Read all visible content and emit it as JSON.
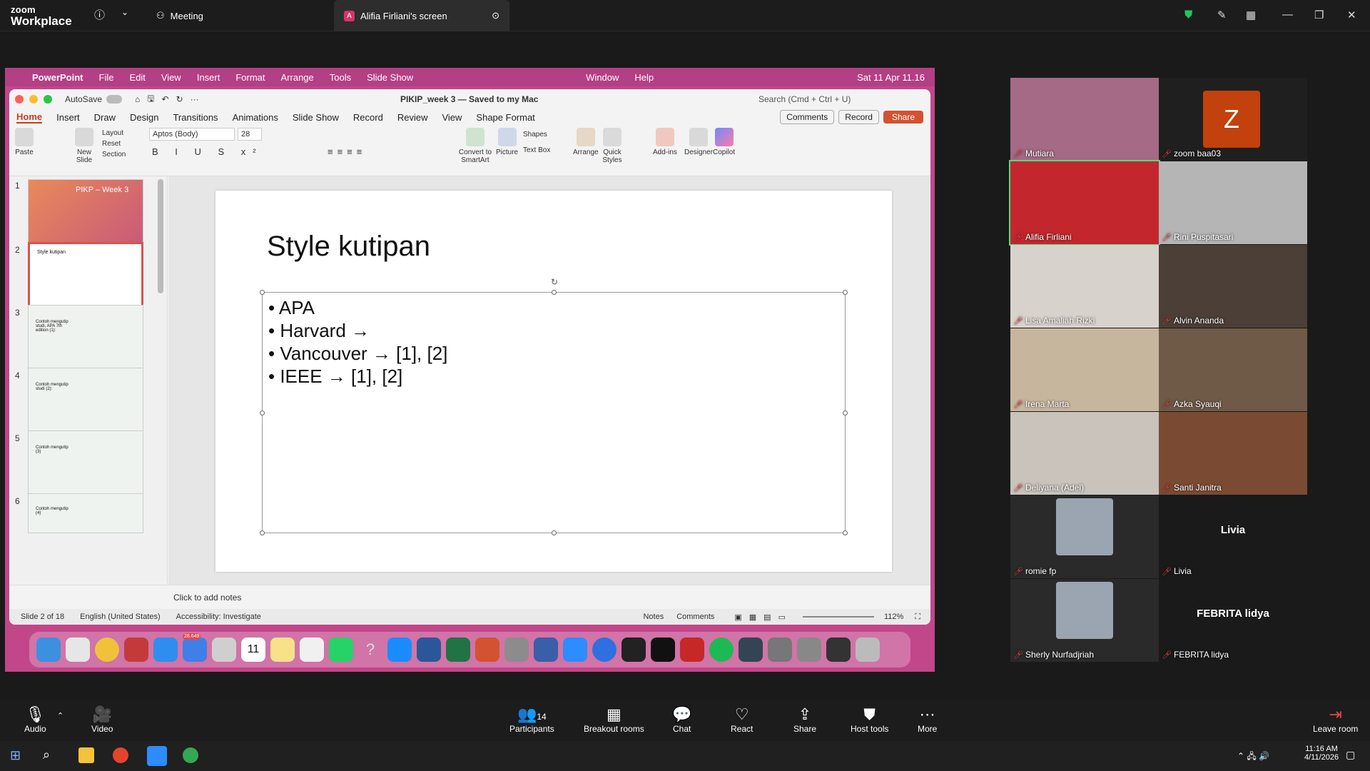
{
  "zoom": {
    "logo_line1": "zoom",
    "logo_line2": "Workplace",
    "tab_meeting": "Meeting",
    "tab_screen": "Alifia Firliani's screen",
    "avatar_letter": "A"
  },
  "mac_menu": {
    "app": "PowerPoint",
    "items": [
      "File",
      "Edit",
      "View",
      "Insert",
      "Format",
      "Arrange",
      "Tools",
      "Slide Show"
    ],
    "right": [
      "Window",
      "Help"
    ],
    "clock": "Sat 11 Apr  11.16"
  },
  "ppt": {
    "autosave": "AutoSave",
    "doc_title": "PIKIP_week 3 — Saved to my Mac",
    "search": "Search (Cmd + Ctrl + U)",
    "tabs": [
      "Home",
      "Insert",
      "Draw",
      "Design",
      "Transitions",
      "Animations",
      "Slide Show",
      "Record",
      "Review",
      "View",
      "Shape Format"
    ],
    "comments": "Comments",
    "record": "Record",
    "share": "Share",
    "font": "Aptos (Body)",
    "size": "28",
    "ribbon": {
      "paste": "Paste",
      "new_slide": "New Slide",
      "layout": "Layout",
      "reset": "Reset",
      "section": "Section",
      "convert": "Convert to SmartArt",
      "picture": "Picture",
      "shapes": "Shapes",
      "textbox": "Text Box",
      "arrange": "Arrange",
      "quick_styles": "Quick Styles",
      "addins": "Add-ins",
      "designer": "Designer",
      "copilot": "Copilot"
    },
    "thumbs": [
      {
        "n": "1",
        "t": "PIKP – Week 3"
      },
      {
        "n": "2",
        "t": "Style kutipan"
      },
      {
        "n": "3",
        "t": "Contoh mengutip studi, APA 7th edition (1):"
      },
      {
        "n": "4",
        "t": "Contoh mengutip studi (2):"
      },
      {
        "n": "5",
        "t": "Contoh mengutip (3)"
      },
      {
        "n": "6",
        "t": "Contoh mengutip (4)"
      }
    ],
    "slide": {
      "title": "Style kutipan",
      "bullets": [
        "• APA",
        "• Harvard → ",
        "• Vancouver → [1], [2]",
        "• IEEE → [1], [2]"
      ]
    },
    "notes": "Click to add notes",
    "status": {
      "slide": "Slide 2 of 18",
      "lang": "English (United States)",
      "access": "Accessibility: Investigate",
      "notes": "Notes",
      "comments": "Comments",
      "zoom": "112%"
    }
  },
  "participants": [
    {
      "name": "Mutiara",
      "bg": "#a46a86"
    },
    {
      "name": "zoom baa03",
      "bg": "#1f1f1f",
      "letter": "Z"
    },
    {
      "name": "Alifia Firliani",
      "bg": "#c4262e"
    },
    {
      "name": "Rini Puspitasari",
      "bg": "#b5b5b5"
    },
    {
      "name": "Lisa Amaliah Rizki",
      "bg": "#d8d2cc"
    },
    {
      "name": "Alvin Ananda",
      "bg": "#4b3f37"
    },
    {
      "name": "Irena Marta",
      "bg": "#c7b69e"
    },
    {
      "name": "Azka Syauqi",
      "bg": "#6e5a46"
    },
    {
      "name": "Deliyana (Adel)",
      "bg": "#c9c3bb"
    },
    {
      "name": "Santi Janitra",
      "bg": "#7a4b32"
    },
    {
      "name": "romie fp",
      "bg": "#2a2a2a"
    },
    {
      "name": "Livia",
      "bg": "#1a1a1a",
      "big": "Livia"
    },
    {
      "name": "Sherly Nurfadjriah",
      "bg": "#2a2a2a"
    },
    {
      "name": "FEBRITA lidya",
      "bg": "#1a1a1a",
      "big": "FEBRITA lidya"
    }
  ],
  "toolbar": {
    "audio": "Audio",
    "video": "Video",
    "participants": "Participants",
    "count": "14",
    "breakout": "Breakout rooms",
    "chat": "Chat",
    "react": "React",
    "share": "Share",
    "host": "Host tools",
    "more": "More",
    "leave": "Leave room"
  },
  "taskbar": {
    "time": "11:16 AM",
    "date": "4/11/2026"
  },
  "dock_badge": "28.649",
  "cal_day": "11"
}
